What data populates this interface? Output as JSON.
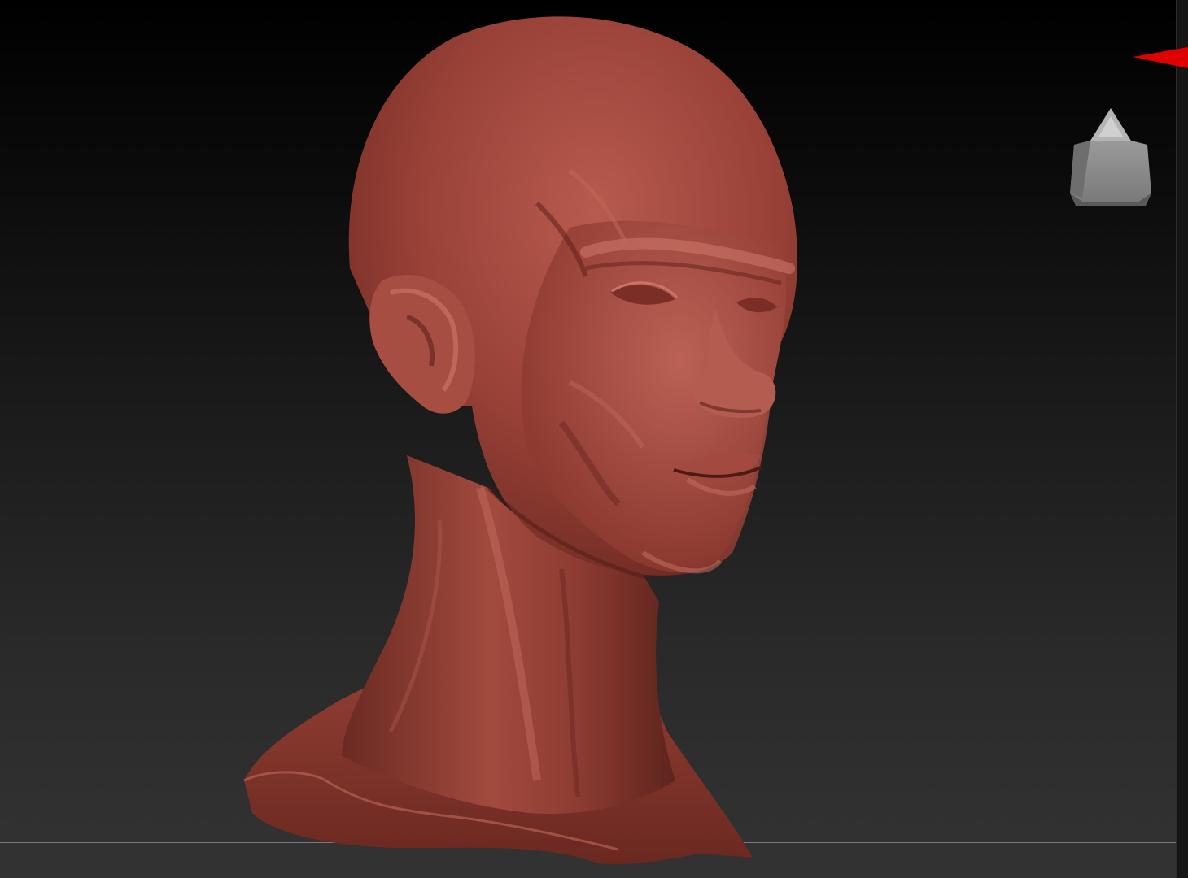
{
  "viewport": {
    "background_top": "#000000",
    "background_bottom": "#333333",
    "guide_line_color": "#8a8a8a"
  },
  "model": {
    "icon": "sculpted-head-model",
    "material_color": "#a0463c"
  },
  "navigation": {
    "marker_icon": "red-triangle-marker-icon",
    "marker_color": "#e00000",
    "cube_icon": "navigation-cube-icon",
    "cube_color": "#8c8c8c"
  }
}
